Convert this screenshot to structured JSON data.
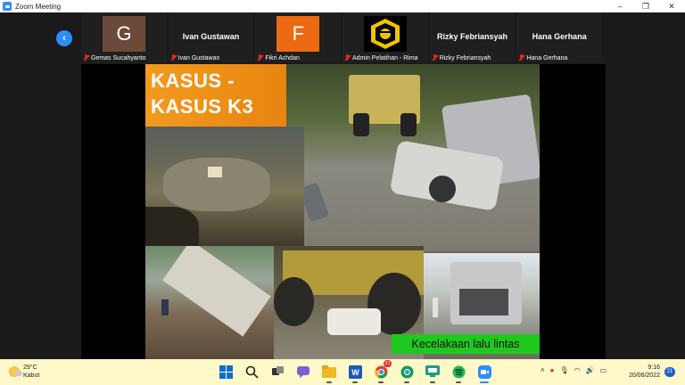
{
  "window": {
    "title": "Zoom Meeting",
    "controls": {
      "minimize": "–",
      "maximize": "❐",
      "close": "✕"
    }
  },
  "participants": [
    {
      "name": "Gemas Sucahyanto",
      "initial": "G",
      "avatar_color": "#6b4a3a",
      "center_name": ""
    },
    {
      "name": "Ivan Gustawan",
      "initial": "",
      "avatar_color": "",
      "center_name": "Ivan Gustawan"
    },
    {
      "name": "Fikri Achdan",
      "initial": "F",
      "avatar_color": "#ec6a12",
      "center_name": ""
    },
    {
      "name": "Admin Pelatihan - Rima",
      "initial": "",
      "avatar_color": "logo",
      "center_name": ""
    },
    {
      "name": "Rizky Febriansyah",
      "initial": "",
      "avatar_color": "",
      "center_name": "Rizky Febriansyah"
    },
    {
      "name": "Hana Gerhana",
      "initial": "",
      "avatar_color": "",
      "center_name": "Hana Gerhana"
    }
  ],
  "slide": {
    "title_line1": "KASUS -",
    "title_line2": "KASUS K3",
    "caption": "Kecelakaan lalu lintas"
  },
  "taskbar": {
    "weather_temp": "29°C",
    "weather_desc": "Kabut",
    "time": "9:16",
    "date": "20/06/2022",
    "notifications": "21",
    "apps": [
      {
        "name": "start-icon",
        "badge": ""
      },
      {
        "name": "search-icon",
        "badge": ""
      },
      {
        "name": "task-view-icon",
        "badge": ""
      },
      {
        "name": "chat-icon",
        "badge": ""
      },
      {
        "name": "file-explorer-icon",
        "badge": ""
      },
      {
        "name": "word-icon",
        "badge": ""
      },
      {
        "name": "chrome-icon",
        "badge": "21"
      },
      {
        "name": "chrome-profile-icon",
        "badge": ""
      },
      {
        "name": "teams-icon",
        "badge": ""
      },
      {
        "name": "spotify-icon",
        "badge": ""
      },
      {
        "name": "zoom-icon",
        "badge": ""
      }
    ]
  },
  "colors": {
    "zoom_blue": "#2d8cff",
    "title_orange": "#f39a1f",
    "caption_green": "#1fc81f",
    "taskbar_bg": "#fff8c8"
  }
}
